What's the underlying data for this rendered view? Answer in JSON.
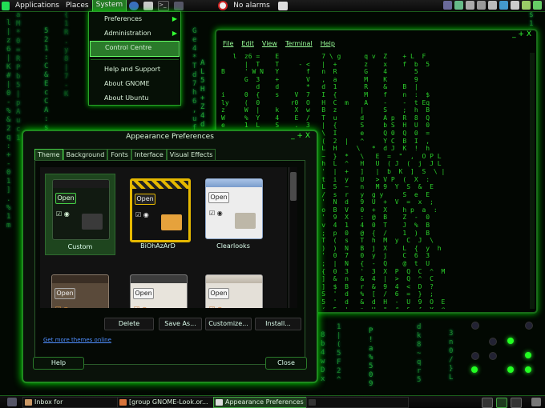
{
  "top_panel": {
    "menus": [
      "Applications",
      "Places",
      "System"
    ],
    "alarm_label": "No alarms"
  },
  "system_menu": {
    "items": [
      "Preferences",
      "Administration",
      "Control Centre",
      "Help and Support",
      "About GNOME",
      "About Ubuntu"
    ]
  },
  "terminal": {
    "controls": "_ + X",
    "menus": [
      "File",
      "Edit",
      "View",
      "Terminal",
      "Help"
    ],
    "lines": [
      "   l  z6 =    E           7 \\ g      q v  Z    + L  F",
      "      |  T    T     - <   |  +       z    x    f  b  5",
      "B     ' W N   Y       f   n  R       G    4       5",
      "      G  3    +       V   ,  a       M    K       9",
      "         d    d       *   d  1       R    &    B  |",
      "i     0  {    s    V  7   I  {       M    f    n  :  $",
      "ly    (  0        r0  O   H  C  m    A    -    -  t Eq",
      "z     W  |    k    X  w   B  z      |     S    ;  h  B",
      "W     %  Y    4    E  /   T  u      d     A p  R  8  Q",
      "e     1  L    S    .  3   |  {      S     b S  H  U  0",
      "c     |  '    3    Z  U   \\  I      e     Q 0  Q  0  =",
      "G     6  G    *    A  S   (  2  |   ^     Y C  B  I  ,",
      "z     S  G    :    d  C   L  H     \\   *  d J  K  !  h",
      "S     ]  A    s    q  E   ~  }  *   \\   E  =  \"  ,  O P L",
      "      [  q    +    i  N   h  L  ^   H   U  ( J  (  j  J L",
      "h     S  N    4    ]  U   '  |  +   ]   |  b  K  ]  S  \\ |",
      "       p    0  &   N  }   t  i  y   U   > V P  (  X  :",
      "    ,  &  $   N    '  h   L  5  ~   n   M 9  Y  S  &  E",
      "    h  2  Y    ^   v  z   /  s  r   y  g y     S  e  E",
      "    C  F  E    D   E  N   '  N  d   9  U  +  V  =  x  ;",
      "(  9  C  S    C    E  D   o  B  V   0  +  X    h p  a  :",
      "S  (    j    i     0  ^   '  9  X   :  @  B    Z  -  0",
      "   [    y         1   0   v  4  1   4  0  T    J  %  B",
      "   l    3    h    c   E   ;  p  0   @  {  /    1  )  B",
      "   S    }    (    h   B   T  (  s   T  h  M  y  C  J  \\",
      "   m    5    k    (   b   )  )  N   B  j  X    L  {  y  h",
      "   3    0    0    f   (   '  0  7   0  y  j    C  6  3",
      "   H    N    a    o   e   ;  |  N   {  -  Q    @  t  U",
      "   $    0    z    1   |   {  0  3   '  3  X  P  Q  C  ^  M",
      "   m    E    (    F   )   ]  &  n   &  4  |  >  Q  ^  C",
      "   I    1    9    x   D   ]  $  B   r  &  9  4  <  D  ?",
      "   P    )    A    1   2   S  '  d   %  [  /  6  =  }  ;",
      "   R    (    t    q   Z   5  '  d   &  d  H  -  U  9  O  E",
      "   1    ]    P    J   %   (  5  |   n  H  \"  #  &  {  X  @"
    ]
  },
  "appearance": {
    "title": "Appearance Preferences",
    "controls": "_ + X",
    "tabs": [
      "Theme",
      "Background",
      "Fonts",
      "Interface",
      "Visual Effects"
    ],
    "themes": [
      {
        "name": "Custom",
        "open_label": "Open"
      },
      {
        "name": "BiOhAzArD",
        "open_label": "Open"
      },
      {
        "name": "Clearlooks",
        "open_label": "Open"
      },
      {
        "name": "",
        "open_label": "Open"
      },
      {
        "name": "",
        "open_label": "Open"
      },
      {
        "name": "",
        "open_label": "Open"
      }
    ],
    "buttons": {
      "delete": "Delete",
      "save_as": "Save As...",
      "customize": "Customize...",
      "install": "Install..."
    },
    "get_more_link": "Get more themes online",
    "help": "Help",
    "close": "Close"
  },
  "bottom_panel": {
    "tasks": [
      "Inbox for",
      "[group GNOME-Look.or...",
      "Appearance Preferences",
      ""
    ]
  },
  "colors": {
    "accent_green": "#2bd12b",
    "menu_highlight": "#2a7a2a",
    "link_blue": "#4f8fff"
  }
}
